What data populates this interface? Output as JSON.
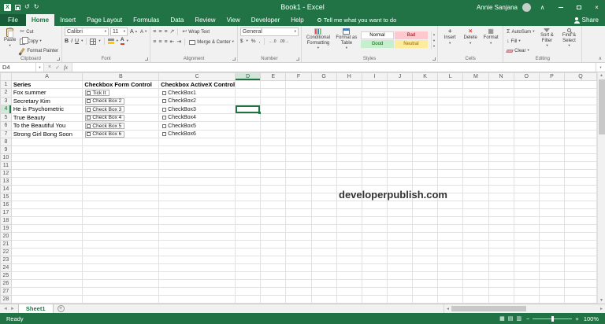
{
  "titlebar": {
    "title": "Book1 - Excel",
    "user_name": "Annie Sanjana"
  },
  "ribbon": {
    "tabs": [
      {
        "label": "File",
        "file": true
      },
      {
        "label": "Home",
        "active": true
      },
      {
        "label": "Insert"
      },
      {
        "label": "Page Layout"
      },
      {
        "label": "Formulas"
      },
      {
        "label": "Data"
      },
      {
        "label": "Review"
      },
      {
        "label": "View"
      },
      {
        "label": "Developer"
      },
      {
        "label": "Help"
      }
    ],
    "tell_me": "Tell me what you want to do",
    "share_label": "Share",
    "groups": {
      "clipboard": {
        "label": "Clipboard",
        "paste": "Paste",
        "cut": "Cut",
        "copy": "Copy",
        "format_painter": "Format Painter"
      },
      "font": {
        "label": "Font",
        "font_name": "Calibri",
        "font_size": "11"
      },
      "alignment": {
        "label": "Alignment",
        "wrap_text": "Wrap Text",
        "merge_center": "Merge & Center"
      },
      "number": {
        "label": "Number",
        "format": "General"
      },
      "styles": {
        "label": "Styles",
        "conditional_formatting": "Conditional Formatting",
        "format_as_table": "Format as Table",
        "gallery": [
          {
            "label": "Normal",
            "bg": "#ffffff",
            "fg": "#000000",
            "border": "#d4d2d0"
          },
          {
            "label": "Bad",
            "bg": "#ffc7ce",
            "fg": "#9c0006",
            "border": "#ffc7ce"
          },
          {
            "label": "Good",
            "bg": "#c6efce",
            "fg": "#006100",
            "border": "#c6efce"
          },
          {
            "label": "Neutral",
            "bg": "#ffeb9c",
            "fg": "#9c6500",
            "border": "#ffeb9c"
          }
        ]
      },
      "cells": {
        "label": "Cells",
        "insert": "Insert",
        "delete": "Delete",
        "format": "Format"
      },
      "editing": {
        "label": "Editing",
        "autosum": "AutoSum",
        "fill": "Fill",
        "clear": "Clear",
        "sort_filter": "Sort & Filter",
        "find_select": "Find & Select"
      }
    }
  },
  "formula_bar": {
    "name_box": "D4",
    "fx_label": "fx",
    "value": ""
  },
  "sheet": {
    "columns": [
      "A",
      "B",
      "C",
      "D",
      "E",
      "F",
      "G",
      "H",
      "I",
      "J",
      "K",
      "L",
      "M",
      "N",
      "O",
      "P",
      "Q"
    ],
    "row_count": 28,
    "selection": {
      "col": "D",
      "row": 4,
      "ref": "D4"
    },
    "headers": {
      "series": "Series",
      "form": "Checkbox Form Control",
      "activex": "Checkbox ActiveX Control"
    },
    "series": [
      "Fox summer",
      "Secretary Kim",
      "He is Psychometric",
      "True Beauty",
      "To the Beautiful You",
      "Strong Girl Bong Soon"
    ],
    "form_checkboxes": [
      "Tick It",
      "Check Box 2",
      "Check Box 3",
      "Check Box 4",
      "Check Box 5",
      "Check Box 6"
    ],
    "activex_checkboxes": [
      "CheckBox1",
      "CheckBox2",
      "CheckBox3",
      "CheckBox4",
      "CheckBox5",
      "CheckBox6"
    ],
    "watermark": "developerpublish.com"
  },
  "sheet_tabs": {
    "tabs": [
      {
        "label": "Sheet1",
        "active": true
      }
    ]
  },
  "status_bar": {
    "status": "Ready",
    "zoom": "100%"
  },
  "colors": {
    "accent": "#217346",
    "selection_border": "#217346"
  }
}
